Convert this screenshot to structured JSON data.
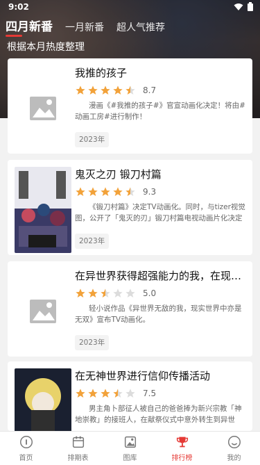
{
  "status": {
    "time": "9:02"
  },
  "tabs": [
    {
      "label": "四月新番",
      "active": true
    },
    {
      "label": "一月新番",
      "active": false
    },
    {
      "label": "超人气推荐",
      "active": false
    }
  ],
  "subtitle": "根据本月热度整理",
  "colors": {
    "accent": "#e53935",
    "star": "#f2a23a",
    "star_empty": "#dcdcdc"
  },
  "items": [
    {
      "title": "我推的孩子",
      "rating": 4.5,
      "score": "8.7",
      "desc": "漫画《#我推的孩子#》官宣动画化决定！将由#动画工房#进行制作！",
      "year": "2023年",
      "thumb": "placeholder-image-icon"
    },
    {
      "title": "鬼灭之刃 锻刀村篇",
      "rating": 4.5,
      "score": "9.3",
      "desc": "《锻刀村篇》决定TV动画化。同时，与tizer视觉图，公开了「鬼灭的刃」锻刀村篇电视动画片化决定PV。",
      "year": "2023年",
      "thumb": "poster-kimetsu"
    },
    {
      "title": "在异世界获得超强能力的我，在现实...",
      "rating": 2.5,
      "score": "5.0",
      "desc": "轻小说作品《异世界无敌的我，现实世界中亦是无双》宣布TV动画化。",
      "year": "2023年",
      "thumb": "placeholder-image-icon"
    },
    {
      "title": "在无神世界进行信仰传播活动",
      "rating": 3.5,
      "score": "7.5",
      "desc": "男主角卜部征人被自己的爸爸捧为新兴宗教「神地崇教」的接班人，在献祭仪式中意外转生到异世界。...",
      "year": "",
      "thumb": "poster-kamisama"
    }
  ],
  "nav": [
    {
      "label": "首页",
      "icon": "home-icon",
      "active": false
    },
    {
      "label": "排期表",
      "icon": "calendar-icon",
      "active": false
    },
    {
      "label": "图库",
      "icon": "gallery-icon",
      "active": false
    },
    {
      "label": "排行榜",
      "icon": "trophy-icon",
      "active": true
    },
    {
      "label": "我的",
      "icon": "profile-icon",
      "active": false
    }
  ]
}
